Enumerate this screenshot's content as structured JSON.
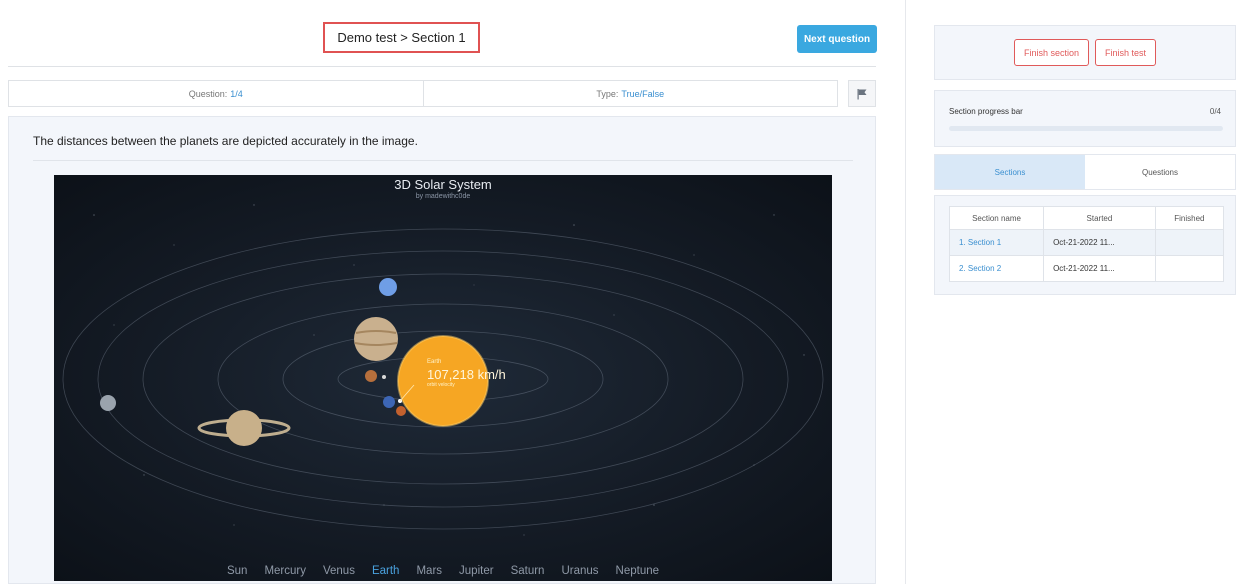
{
  "header": {
    "breadcrumb": "Demo test > Section 1",
    "next_button": "Next question"
  },
  "info_bar": {
    "question_label": "Question:",
    "question_value": "1/4",
    "type_label": "Type:",
    "type_value": "True/False",
    "flag_icon": "flag-icon"
  },
  "question": {
    "text": "The distances between the planets are depicted accurately in the image."
  },
  "image": {
    "title": "3D Solar System",
    "subtitle": "by madewithc0de",
    "sun_tooltip_label": "Earth",
    "sun_tooltip_speed": "107,218 km/h",
    "sun_tooltip_sub": "orbit velocity",
    "planets": [
      "Sun",
      "Mercury",
      "Venus",
      "Earth",
      "Mars",
      "Jupiter",
      "Saturn",
      "Uranus",
      "Neptune"
    ],
    "active_planet": "Earth"
  },
  "side": {
    "finish_section": "Finish section",
    "finish_test": "Finish test",
    "progress_label": "Section progress bar",
    "progress_count": "0/4",
    "progress_fraction": 0,
    "tabs": [
      "Sections",
      "Questions"
    ],
    "table": {
      "headers": [
        "Section name",
        "Started",
        "Finished"
      ],
      "rows": [
        {
          "name": "1. Section 1",
          "started": "Oct-21-2022 11...",
          "finished": ""
        },
        {
          "name": "2. Section 2",
          "started": "Oct-21-2022 11...",
          "finished": ""
        }
      ]
    }
  },
  "colors": {
    "accent": "#3aa8e0",
    "danger": "#e05a5a",
    "active_planet": "#4aa3e0"
  }
}
